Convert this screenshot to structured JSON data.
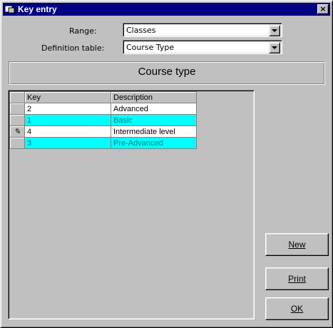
{
  "window": {
    "title": "Key entry",
    "close_label": "×"
  },
  "form": {
    "range_label": "Range:",
    "range_value": "Classes",
    "deftable_label": "Definition table:",
    "deftable_value": "Course Type"
  },
  "heading": "Course type",
  "grid": {
    "columns": [
      "Key",
      "Description"
    ],
    "edit_marker": "✎",
    "rows": [
      {
        "key": "2",
        "description": "Advanced",
        "style": "white",
        "editing": false
      },
      {
        "key": "1",
        "description": "Basic",
        "style": "cyan",
        "editing": false
      },
      {
        "key": "4",
        "description": "Intermediate level",
        "style": "white",
        "editing": true
      },
      {
        "key": "3",
        "description": "Pre-Advanced",
        "style": "cyan",
        "editing": false
      }
    ]
  },
  "buttons": {
    "new": "New",
    "print": "Print",
    "ok": "OK"
  },
  "colors": {
    "titlebar": "#000080",
    "row_highlight": "#00ffff",
    "window": "#c0c0c0"
  },
  "icons": {
    "title": "app-icon",
    "close": "close-icon",
    "dropdown": "chevron-down-icon",
    "edit": "pencil-icon"
  }
}
